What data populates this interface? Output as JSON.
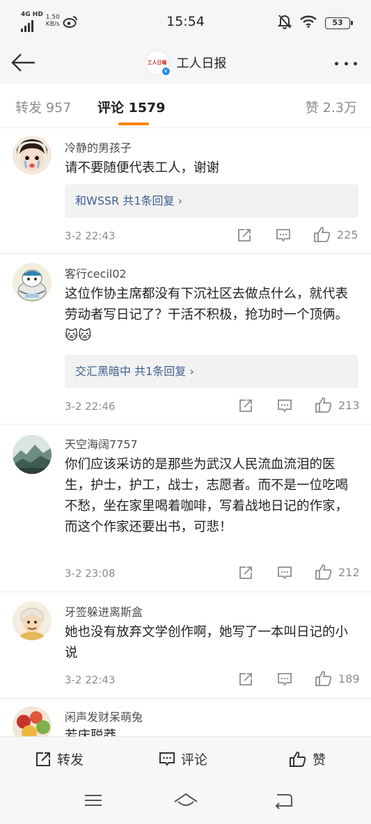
{
  "status_bar": {
    "network": "4G HD",
    "speed": "1.50",
    "speed_unit": "KB/s",
    "time": "15:54",
    "battery": "53"
  },
  "nav": {
    "title": "工人日报",
    "logo_text": "工人日報"
  },
  "tabs": {
    "forward": "转发 957",
    "comment": "评论 1579",
    "like": "赞 2.3万"
  },
  "comments": [
    {
      "name": "冷静的男孩子",
      "text": "请不要随便代表工人，谢谢",
      "reply": "和WSSR  共1条回复 ›",
      "time": "3-2 22:43",
      "likes": "225"
    },
    {
      "name": "客行cecil02",
      "text": "这位作协主席都没有下沉社区去做点什么，就代表劳动者写日记了？干活不积极，抢功时一个顶俩。🐱🐱",
      "reply": "交汇黑暗中  共1条回复 ›",
      "time": "3-2 22:46",
      "likes": "213"
    },
    {
      "name": "天空海阔7757",
      "text": "你们应该采访的是那些为武汉人民流血流泪的医生，护士，护工，战士，志愿者。而不是一位吃喝不愁，坐在家里喝着咖啡，写着战地日记的作家，而这个作家还要出书，可悲！",
      "time": "3-2 23:08",
      "likes": "212"
    },
    {
      "name": "牙签躲进离斯盒",
      "text": "她也没有放弃文学创作啊，她写了一本叫日记的小说",
      "time": "3-2 22:43",
      "likes": "189"
    },
    {
      "name": "闲声发财呆萌兔",
      "text": "若庆聪莽"
    }
  ],
  "bottom_bar": {
    "forward": "转发",
    "comment": "评论",
    "like": "赞"
  },
  "colors": {
    "accent": "#ff8200",
    "link": "#3c5e8e",
    "muted": "#8d8d8d"
  }
}
